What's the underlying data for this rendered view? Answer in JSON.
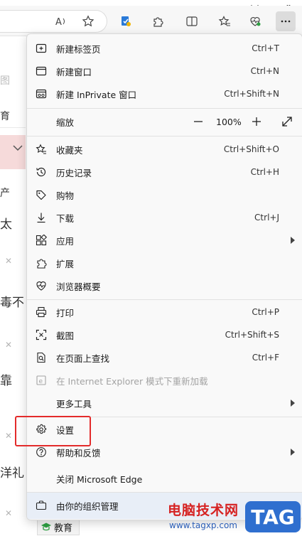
{
  "menu": {
    "new_tab": {
      "label": "新建标签页",
      "shortcut": "Ctrl+T"
    },
    "new_window": {
      "label": "新建窗口",
      "shortcut": "Ctrl+N"
    },
    "new_inprivate": {
      "label": "新建 InPrivate 窗口",
      "shortcut": "Ctrl+Shift+N"
    },
    "zoom": {
      "label": "缩放",
      "value": "100%"
    },
    "favorites": {
      "label": "收藏夹",
      "shortcut": "Ctrl+Shift+O"
    },
    "history": {
      "label": "历史记录",
      "shortcut": "Ctrl+H"
    },
    "shopping": {
      "label": "购物"
    },
    "downloads": {
      "label": "下载",
      "shortcut": "Ctrl+J"
    },
    "apps": {
      "label": "应用"
    },
    "extensions": {
      "label": "扩展"
    },
    "browser_essentials": {
      "label": "浏览器概要"
    },
    "print": {
      "label": "打印",
      "shortcut": "Ctrl+P"
    },
    "screenshot": {
      "label": "截图",
      "shortcut": "Ctrl+Shift+S"
    },
    "find_on_page": {
      "label": "在页面上查找",
      "shortcut": "Ctrl+F"
    },
    "ie_mode": {
      "label": "在 Internet Explorer 模式下重新加载"
    },
    "more_tools": {
      "label": "更多工具"
    },
    "settings": {
      "label": "设置"
    },
    "help": {
      "label": "帮助和反馈"
    },
    "close_edge": {
      "label": "关闭 Microsoft Edge"
    },
    "managed": {
      "label": "由你的组织管理"
    }
  },
  "background_page": {
    "fragments": [
      "育",
      "产",
      "太",
      "毒不",
      "靠",
      "洋礼"
    ],
    "tab_label": "教育"
  },
  "watermark": {
    "title": "电脑技术网",
    "url": "www.tagxp.com",
    "logo": "TAG"
  },
  "colors": {
    "highlight": "#e32b2b",
    "menu_bg": "#f9f9f9",
    "org_row_bg": "#e8eef7",
    "watermark_red": "#d62222",
    "watermark_blue": "#2f6fcf"
  }
}
